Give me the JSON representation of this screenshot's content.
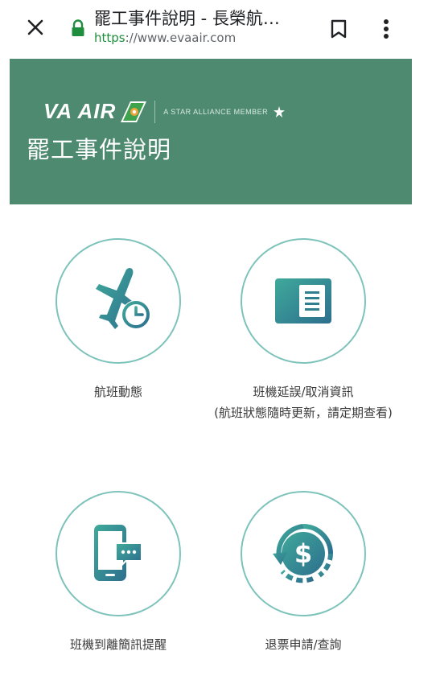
{
  "browser": {
    "title": "罷工事件說明 - 長榮航…",
    "url_scheme": "https",
    "url_rest": "://www.evaair.com"
  },
  "banner": {
    "logo_text": "VA AIR",
    "alliance_text": "A STAR ALLIANCE MEMBER",
    "title": "罷工事件說明",
    "background": "#4e8a70"
  },
  "tiles": [
    {
      "icon": "flight-status-icon",
      "label": "航班動態"
    },
    {
      "icon": "delay-info-icon",
      "label": "班機延誤/取消資訊",
      "note": "(航班狀態隨時更新，請定期查看)"
    },
    {
      "icon": "sms-reminder-icon",
      "label": "班機到離簡訊提醒"
    },
    {
      "icon": "refund-icon",
      "label": "退票申請/查詢"
    }
  ],
  "colors": {
    "accent": "#7ec3bb",
    "icon_gradient_start": "#3fa99a",
    "icon_gradient_end": "#2d6f8e",
    "lock": "#1e8e3e"
  }
}
